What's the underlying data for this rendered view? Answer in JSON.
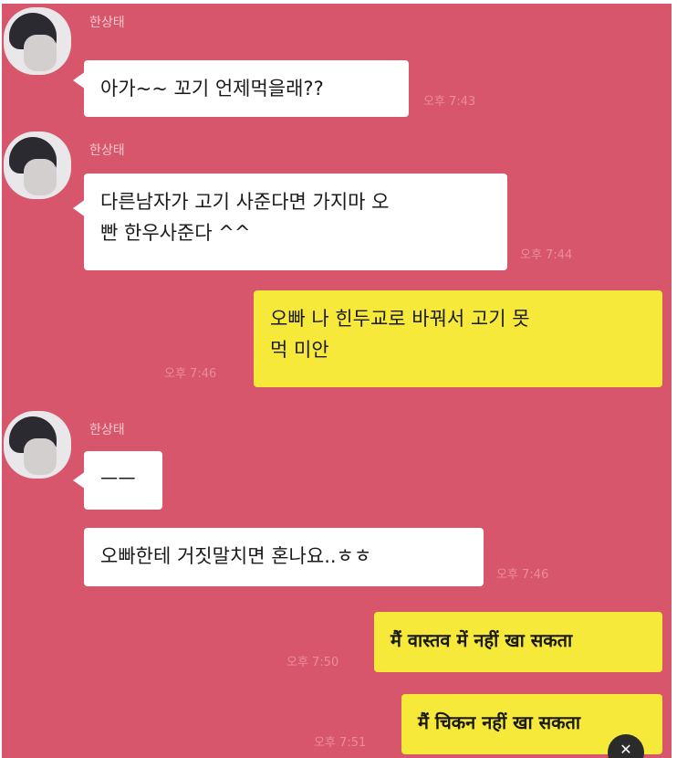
{
  "chat": {
    "sender_name": "한상태",
    "messages": [
      {
        "text": "아가~~ 꼬기 언제먹을래??",
        "time": "오후 7:43"
      },
      {
        "text": "다른남자가 고기 사준다면 가지마 오\n빤 한우사준다 ^^",
        "time": "오후 7:44"
      },
      {
        "text": "오빠 나 힌두교로 바꿔서 고기 못\n먹 미안",
        "time": "오후 7:46"
      },
      {
        "text": "ㅡㅡ"
      },
      {
        "text": "오빠한테 거짓말치면 혼나요..ㅎㅎ",
        "time": "오후 7:46"
      },
      {
        "text": "मैं वास्तव में नहीं खा सकता",
        "time": "오후 7:50"
      },
      {
        "text": "मैं चिकन नहीं खा सकता",
        "time": "오후 7:51"
      }
    ]
  },
  "icons": {
    "avatar": "profile-photo",
    "corner": "close-icon"
  },
  "colors": {
    "background": "#d8566c",
    "incoming_bubble": "#ffffff",
    "outgoing_bubble": "#f7e93a"
  }
}
